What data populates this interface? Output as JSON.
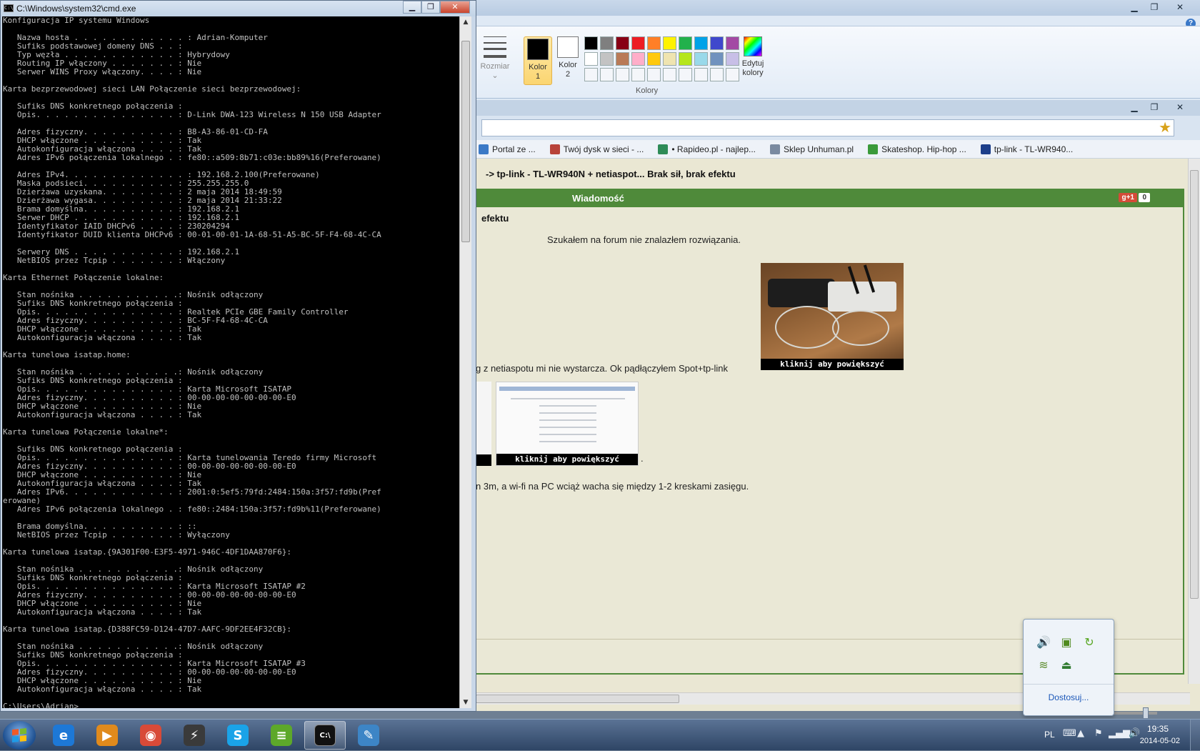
{
  "paint": {
    "size_label": "Rozmiar",
    "color1_label_line1": "Kolor",
    "color1_label_line2": "1",
    "color2_label_line1": "Kolor",
    "color2_label_line2": "2",
    "palette_label": "Kolory",
    "edit_colors_line1": "Edytuj",
    "edit_colors_line2": "kolory",
    "help_glyph": "?",
    "palette_colors": [
      "#000000",
      "#7f7f7f",
      "#880015",
      "#ed1c24",
      "#ff7f27",
      "#fff200",
      "#22b14c",
      "#00a2e8",
      "#3f48cc",
      "#a349a4",
      "#ffffff",
      "#c3c3c3",
      "#b97a57",
      "#ffaec9",
      "#ffc90e",
      "#efe4b0",
      "#b5e61d",
      "#99d9ea",
      "#7092be",
      "#c8bfe7",
      "#f4f6fa",
      "#f4f6fa",
      "#f4f6fa",
      "#f4f6fa",
      "#f4f6fa",
      "#f4f6fa",
      "#f4f6fa",
      "#f4f6fa",
      "#f4f6fa",
      "#f4f6fa"
    ]
  },
  "browser": {
    "favorites": [
      {
        "label": "Portal ze ...",
        "color": "#3b79c6"
      },
      {
        "label": "Twój dysk w sieci - ...",
        "color": "#b8433a"
      },
      {
        "label": "• Rapideo.pl - najlep...",
        "color": "#2e8b57"
      },
      {
        "label": "Sklep Unhuman.pl",
        "color": "#7a8aa0"
      },
      {
        "label": "Skateshop. Hip-hop ...",
        "color": "#3a9a3a"
      },
      {
        "label": "tp-link - TL-WR940...",
        "color": "#1d3f8a"
      }
    ],
    "thread_title": "-> tp-link - TL-WR940N + netiaspot... Brak sił, brak efektu",
    "post_header_label": "Wiadomość",
    "gplus_label": "g+1",
    "gplus_count": "0",
    "post_title": "efektu",
    "post_line1": "Szukałem na forum nie znalazłem rozwiązania.",
    "post_line2": "g z netiaspotu mi nie wystarcza. Ok pądłączyłem Spot+tp-link",
    "post_line2_dot": ".",
    "post_line3": "n 3m, a wi-fi na PC wciąż wacha się między 1-2 kreskami zasięgu.",
    "image_caption": "kliknij aby powiększyć"
  },
  "cmd": {
    "title": "C:\\Windows\\system32\\cmd.exe",
    "icon_text": "C:\\",
    "lines": [
      "Konfiguracja IP systemu Windows",
      "",
      "   Nazwa hosta . . . . . . . . . . . . : Adrian-Komputer",
      "   Sufiks podstawowej domeny DNS . . :",
      "   Typ węzła . . . . . . . . . . . . : Hybrydowy",
      "   Routing IP włączony . . . . . . . : Nie",
      "   Serwer WINS Proxy włączony. . . . : Nie",
      "",
      "Karta bezprzewodowej sieci LAN Połączenie sieci bezprzewodowej:",
      "",
      "   Sufiks DNS konkretnego połączenia :",
      "   Opis. . . . . . . . . . . . . . . : D-Link DWA-123 Wireless N 150 USB Adapter",
      "",
      "   Adres fizyczny. . . . . . . . . . : B8-A3-86-01-CD-FA",
      "   DHCP włączone . . . . . . . . . . : Tak",
      "   Autokonfiguracja włączona . . . . : Tak",
      "   Adres IPv6 połączenia lokalnego . : fe80::a509:8b71:c03e:bb89%16(Preferowane)",
      "",
      "   Adres IPv4. . . . . . . . . . . . . : 192.168.2.100(Preferowane)",
      "   Maska podsieci. . . . . . . . . . : 255.255.255.0",
      "   Dzierżawa uzyskana. . . . . . . . : 2 maja 2014 18:49:59",
      "   Dzierżawa wygasa. . . . . . . . . : 2 maja 2014 21:33:22",
      "   Brama domyślna. . . . . . . . . . : 192.168.2.1",
      "   Serwer DHCP . . . . . . . . . . . : 192.168.2.1",
      "   Identyfikator IAID DHCPv6 . . . . : 230204294",
      "   Identyfikator DUID klienta DHCPv6 : 00-01-00-01-1A-68-51-A5-BC-5F-F4-68-4C-CA",
      "",
      "   Serwery DNS . . . . . . . . . . . : 192.168.2.1",
      "   NetBIOS przez Tcpip . . . . . . . : Włączony",
      "",
      "Karta Ethernet Połączenie lokalne:",
      "",
      "   Stan nośnika . . . . . . . . . . .: Nośnik odłączony",
      "   Sufiks DNS konkretnego połączenia :",
      "   Opis. . . . . . . . . . . . . . . : Realtek PCIe GBE Family Controller",
      "   Adres fizyczny. . . . . . . . . . : BC-5F-F4-68-4C-CA",
      "   DHCP włączone . . . . . . . . . . : Tak",
      "   Autokonfiguracja włączona . . . . : Tak",
      "",
      "Karta tunelowa isatap.home:",
      "",
      "   Stan nośnika . . . . . . . . . . .: Nośnik odłączony",
      "   Sufiks DNS konkretnego połączenia :",
      "   Opis. . . . . . . . . . . . . . . : Karta Microsoft ISATAP",
      "   Adres fizyczny. . . . . . . . . . : 00-00-00-00-00-00-00-E0",
      "   DHCP włączone . . . . . . . . . . : Nie",
      "   Autokonfiguracja włączona . . . . : Tak",
      "",
      "Karta tunelowa Połączenie lokalne*:",
      "",
      "   Sufiks DNS konkretnego połączenia :",
      "   Opis. . . . . . . . . . . . . . . : Karta tunelowania Teredo firmy Microsoft",
      "   Adres fizyczny. . . . . . . . . . : 00-00-00-00-00-00-00-E0",
      "   DHCP włączone . . . . . . . . . . : Nie",
      "   Autokonfiguracja włączona . . . . : Tak",
      "   Adres IPv6. . . . . . . . . . . . : 2001:0:5ef5:79fd:2484:150a:3f57:fd9b(Pref",
      "erowane)",
      "   Adres IPv6 połączenia lokalnego . : fe80::2484:150a:3f57:fd9b%11(Preferowane)",
      "",
      "   Brama domyślna. . . . . . . . . . : ::",
      "   NetBIOS przez Tcpip . . . . . . . : Wyłączony",
      "",
      "Karta tunelowa isatap.{9A301F00-E3F5-4971-946C-4DF1DAA870F6}:",
      "",
      "   Stan nośnika . . . . . . . . . . .: Nośnik odłączony",
      "   Sufiks DNS konkretnego połączenia :",
      "   Opis. . . . . . . . . . . . . . . : Karta Microsoft ISATAP #2",
      "   Adres fizyczny. . . . . . . . . . : 00-00-00-00-00-00-00-E0",
      "   DHCP włączone . . . . . . . . . . : Nie",
      "   Autokonfiguracja włączona . . . . : Tak",
      "",
      "Karta tunelowa isatap.{D388FC59-D124-47D7-AAFC-9DF2EE4F32CB}:",
      "",
      "   Stan nośnika . . . . . . . . . . .: Nośnik odłączony",
      "   Sufiks DNS konkretnego połączenia :",
      "   Opis. . . . . . . . . . . . . . . : Karta Microsoft ISATAP #3",
      "   Adres fizyczny. . . . . . . . . . : 00-00-00-00-00-00-00-E0",
      "   DHCP włączone . . . . . . . . . . : Nie",
      "   Autokonfiguracja włączona . . . . : Tak",
      "",
      "C:\\Users\\Adrian>_"
    ]
  },
  "tray_popup": {
    "customize_label": "Dostosuj...",
    "icons": [
      "speaker-icon",
      "nvidia-icon",
      "sync-icon",
      "bluestacks-icon",
      "usb-safe-remove-icon"
    ]
  },
  "taskbar": {
    "apps": [
      {
        "name": "internet-explorer",
        "glyph": "e",
        "color": "#1d78d6"
      },
      {
        "name": "media-player",
        "glyph": "▶",
        "color": "#e08a1c"
      },
      {
        "name": "chrome",
        "glyph": "◉",
        "color": "#d84a38"
      },
      {
        "name": "flash-shield",
        "glyph": "⚡",
        "color": "#3a3a3a"
      },
      {
        "name": "skype",
        "glyph": "S",
        "color": "#1aa3e8"
      },
      {
        "name": "bluestacks",
        "glyph": "≡",
        "color": "#5da82a"
      },
      {
        "name": "cmd",
        "glyph": "C:\\",
        "color": "#111111"
      },
      {
        "name": "paint",
        "glyph": "✎",
        "color": "#3d85c6"
      }
    ],
    "language": "PL",
    "time": "19:35",
    "date": "2014-05-02"
  }
}
